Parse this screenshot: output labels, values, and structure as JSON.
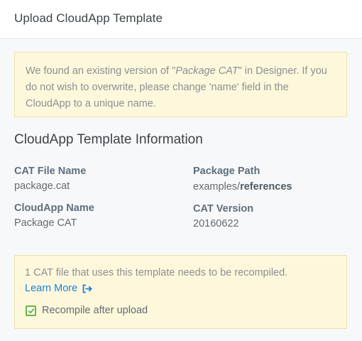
{
  "header": {
    "title": "Upload CloudApp Template"
  },
  "warning": {
    "prefix": "We found an existing version of \"",
    "package_name": "Package CAT",
    "suffix": "\" in Designer. If you do not wish to overwrite, please change 'name' field in the CloudApp to a unique name."
  },
  "info": {
    "heading": "CloudApp Template Information",
    "cat_file_name_label": "CAT File Name",
    "cat_file_name_value": "package.cat",
    "package_path_label": "Package Path",
    "package_path_prefix": "examples/",
    "package_path_bold": "references",
    "cloudapp_name_label": "CloudApp Name",
    "cloudapp_name_value": "Package CAT",
    "cat_version_label": "CAT Version",
    "cat_version_value": "20160622"
  },
  "recompile": {
    "message": "1 CAT file that uses this template needs to be recompiled.",
    "learn_more": "Learn More",
    "checkbox_label": "Recompile after upload",
    "checkbox_checked": true
  },
  "colors": {
    "link": "#1f7fd6",
    "checkbox": "#6bb33a",
    "notice_bg": "#fdf8dc"
  },
  "icons": {
    "learn_more": "external-link-icon",
    "checkbox": "checkmark-icon"
  }
}
